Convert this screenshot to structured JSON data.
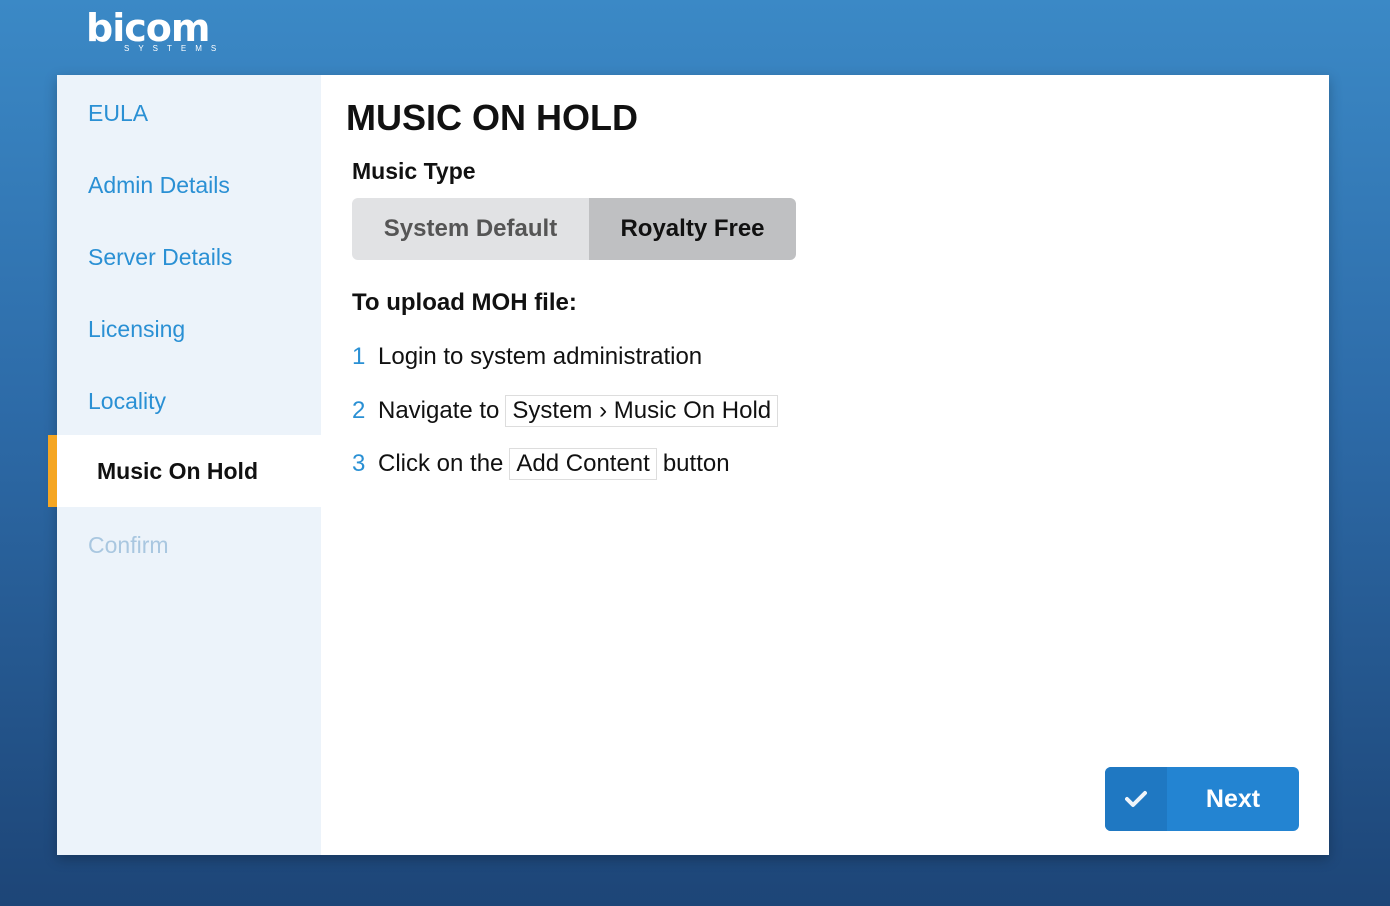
{
  "brand": {
    "name": "bicom",
    "tagline": "SYSTEMS"
  },
  "sidebar": {
    "items": [
      {
        "label": "EULA",
        "state": "done"
      },
      {
        "label": "Admin Details",
        "state": "done"
      },
      {
        "label": "Server Details",
        "state": "done"
      },
      {
        "label": "Licensing",
        "state": "done"
      },
      {
        "label": "Locality",
        "state": "done"
      },
      {
        "label": "Music On Hold",
        "state": "active"
      },
      {
        "label": "Confirm",
        "state": "disabled"
      }
    ]
  },
  "main": {
    "title": "MUSIC ON HOLD",
    "music_type_label": "Music Type",
    "music_type_options": [
      "System Default",
      "Royalty Free"
    ],
    "music_type_selected": "Royalty Free",
    "upload_heading": "To upload MOH file:",
    "steps": [
      {
        "num": "1",
        "pre": "Login to system administration"
      },
      {
        "num": "2",
        "pre": "Navigate to",
        "chip": "System › Music On Hold"
      },
      {
        "num": "3",
        "pre": "Click on the",
        "chip": "Add Content",
        "post": "button"
      }
    ],
    "next_label": "Next",
    "next_icon": "check-icon"
  },
  "colors": {
    "accent": "#2384d2",
    "active_marker": "#f5a623",
    "link": "#2a90d4"
  }
}
